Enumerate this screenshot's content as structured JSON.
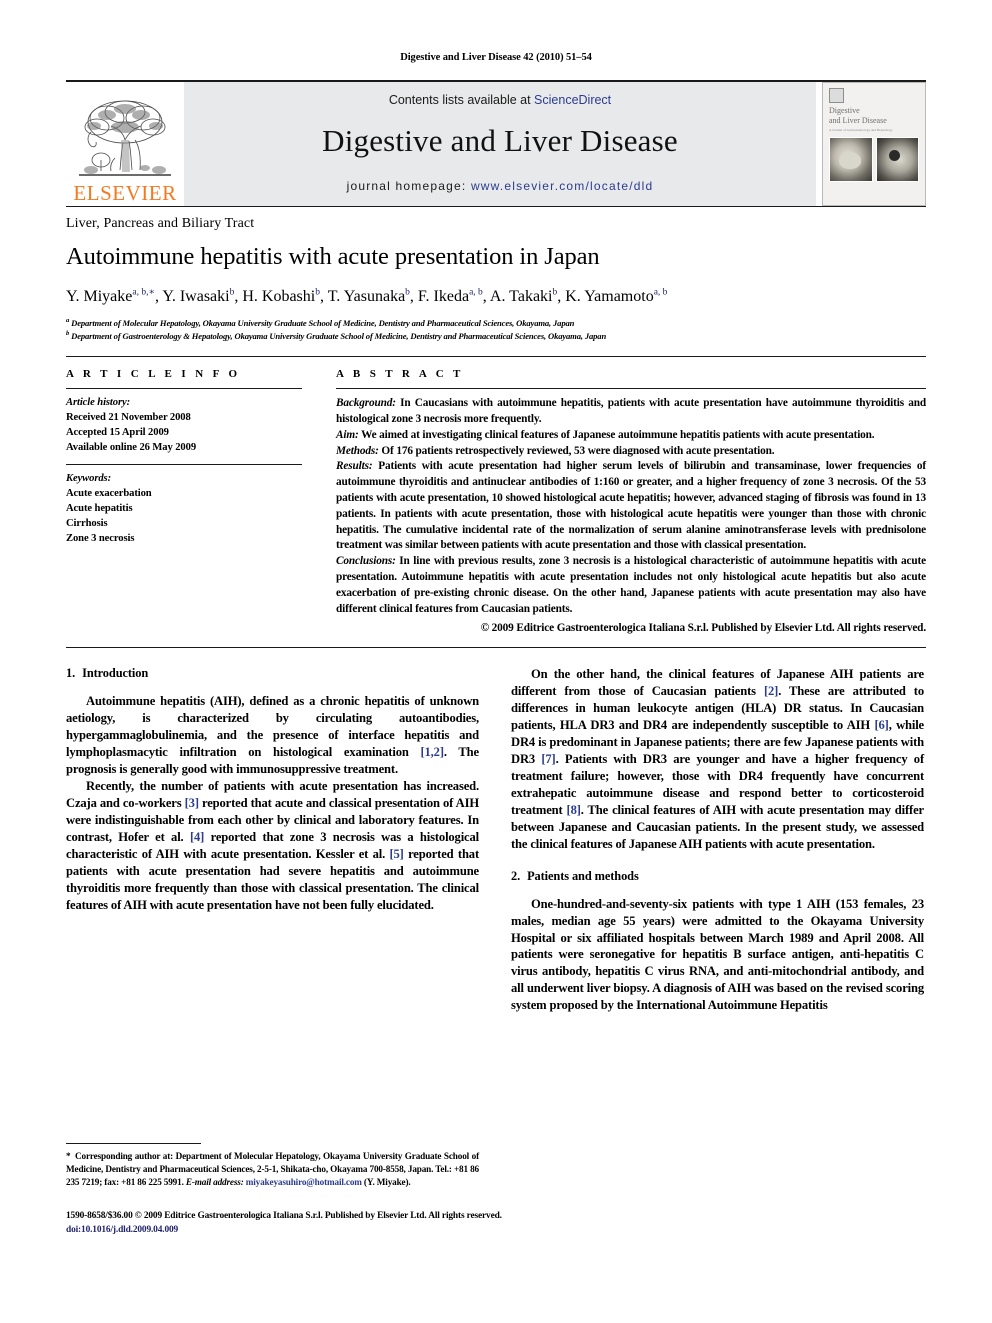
{
  "running_head": "Digestive and Liver Disease 42 (2010) 51–54",
  "masthead": {
    "publisher_logo_text": "ELSEVIER",
    "publisher_logo_color": "#F47920",
    "contents_prefix": "Contents lists available at ",
    "contents_link": "ScienceDirect",
    "journal_title": "Digestive and Liver Disease",
    "homepage_prefix": "journal homepage: ",
    "homepage_url": "www.elsevier.com/locate/dld",
    "band_color": "#e8e9ea",
    "link_color": "#2b3c8f",
    "cover": {
      "title_line1": "Digestive",
      "title_line2": "and Liver Disease",
      "subtitle": "A Journal of Gastroenterology and Hepatology"
    }
  },
  "article": {
    "section_label": "Liver, Pancreas and Biliary Tract",
    "title": "Autoimmune hepatitis with acute presentation in Japan",
    "authors_html": "Y. Miyake<sup>a, b,∗</sup>, Y. Iwasaki<sup>b</sup>, H. Kobashi<sup>b</sup>, T. Yasunaka<sup>b</sup>, F. Ikeda<sup>a, b</sup>, A. Takaki<sup>b</sup>, K. Yamamoto<sup>a, b</sup>",
    "affiliation_a": "Department of Molecular Hepatology, Okayama University Graduate School of Medicine, Dentistry and Pharmaceutical Sciences, Okayama, Japan",
    "affiliation_b": "Department of Gastroenterology & Hepatology, Okayama University Graduate School of Medicine, Dentistry and Pharmaceutical Sciences, Okayama, Japan"
  },
  "article_info": {
    "heading": "A R T I C L E    I N F O",
    "history_label": "Article history:",
    "received": "Received 21 November 2008",
    "accepted": "Accepted 15 April 2009",
    "available_online": "Available online 26 May 2009",
    "keywords_label": "Keywords:",
    "keywords": [
      "Acute exacerbation",
      "Acute hepatitis",
      "Cirrhosis",
      "Zone 3 necrosis"
    ]
  },
  "abstract": {
    "heading": "A B S T R A C T",
    "background_label": "Background:",
    "background_text": " In Caucasians with autoimmune hepatitis, patients with acute presentation have autoimmune thyroiditis and histological zone 3 necrosis more frequently.",
    "aim_label": "Aim:",
    "aim_text": " We aimed at investigating clinical features of Japanese autoimmune hepatitis patients with acute presentation.",
    "methods_label": "Methods:",
    "methods_text": " Of 176 patients retrospectively reviewed, 53 were diagnosed with acute presentation.",
    "results_label": "Results:",
    "results_text": " Patients with acute presentation had higher serum levels of bilirubin and transaminase, lower frequencies of autoimmune thyroiditis and antinuclear antibodies of 1:160 or greater, and a higher frequency of zone 3 necrosis. Of the 53 patients with acute presentation, 10 showed histological acute hepatitis; however, advanced staging of fibrosis was found in 13 patients. In patients with acute presentation, those with histological acute hepatitis were younger than those with chronic hepatitis. The cumulative incidental rate of the normalization of serum alanine aminotransferase levels with prednisolone treatment was similar between patients with acute presentation and those with classical presentation.",
    "conclusions_label": "Conclusions:",
    "conclusions_text": " In line with previous results, zone 3 necrosis is a histological characteristic of autoimmune hepatitis with acute presentation. Autoimmune hepatitis with acute presentation includes not only histological acute hepatitis but also acute exacerbation of pre-existing chronic disease. On the other hand, Japanese patients with acute presentation may also have different clinical features from Caucasian patients.",
    "copyright": "© 2009 Editrice Gastroenterologica Italiana S.r.l. Published by Elsevier Ltd. All rights reserved."
  },
  "body": {
    "intro_heading_num": "1.",
    "intro_heading_text": "Introduction",
    "intro_p1_a": "Autoimmune hepatitis (AIH), defined as a chronic hepatitis of unknown aetiology, is characterized by circulating autoantibodies, hypergammaglobulinemia, and the presence of interface hepatitis and lymphoplasmacytic infiltration on histological examination ",
    "intro_p1_ref": "[1,2]",
    "intro_p1_b": ". The prognosis is generally good with immunosuppressive treatment.",
    "intro_p2_a": "Recently, the number of patients with acute presentation has increased. Czaja and co-workers ",
    "intro_p2_ref1": "[3]",
    "intro_p2_b": " reported that acute and classical presentation of AIH were indistinguishable from each other by clinical and laboratory features. In contrast, Hofer et al. ",
    "intro_p2_ref2": "[4]",
    "intro_p2_c": " reported that zone 3 necrosis was a histological characteristic of AIH with acute presentation. Kessler et al. ",
    "intro_p2_ref3": "[5]",
    "intro_p2_d": " reported that patients with acute presentation had severe hepatitis and autoimmune thyroiditis more frequently than those with classical presentation. The clinical features of AIH with acute presentation have not been fully elucidated.",
    "right_p1_a": "On the other hand, the clinical features of Japanese AIH patients are different from those of Caucasian patients ",
    "right_p1_ref1": "[2]",
    "right_p1_b": ". These are attributed to differences in human leukocyte antigen (HLA) DR status. In Caucasian patients, HLA DR3 and DR4 are independently susceptible to AIH ",
    "right_p1_ref2": "[6]",
    "right_p1_c": ", while DR4 is predominant in Japanese patients; there are few Japanese patients with DR3 ",
    "right_p1_ref3": "[7]",
    "right_p1_d": ". Patients with DR3 are younger and have a higher frequency of treatment failure; however, those with DR4 frequently have concurrent extrahepatic autoimmune disease and respond better to corticosteroid treatment ",
    "right_p1_ref4": "[8]",
    "right_p1_e": ". The clinical features of AIH with acute presentation may differ between Japanese and Caucasian patients. In the present study, we assessed the clinical features of Japanese AIH patients with acute presentation.",
    "methods_heading_num": "2.",
    "methods_heading_text": "Patients and methods",
    "methods_p1": "One-hundred-and-seventy-six patients with type 1 AIH (153 females, 23 males, median age 55 years) were admitted to the Okayama University Hospital or six affiliated hospitals between March 1989 and April 2008. All patients were seronegative for hepatitis B surface antigen, anti-hepatitis C virus antibody, hepatitis C virus RNA, and anti-mitochondrial antibody, and all underwent liver biopsy. A diagnosis of AIH was based on the revised scoring system proposed by the International Autoimmune Hepatitis"
  },
  "footnote": {
    "star": "*",
    "text": " Corresponding author at: Department of Molecular Hepatology, Okayama University Graduate School of Medicine, Dentistry and Pharmaceutical Sciences, 2-5-1, Shikata-cho, Okayama 700-8558, Japan. Tel.: +81 86 235 7219; fax: +81 86 225 5991.",
    "email_label": "E-mail address:",
    "email": "miyakeyasuhiro@hotmail.com",
    "email_suffix": " (Y. Miyake)."
  },
  "colophon": {
    "issn_line": "1590-8658/$36.00 © 2009 Editrice Gastroenterologica Italiana S.r.l. Published by Elsevier Ltd. All rights reserved.",
    "doi": "doi:10.1016/j.dld.2009.04.009"
  }
}
